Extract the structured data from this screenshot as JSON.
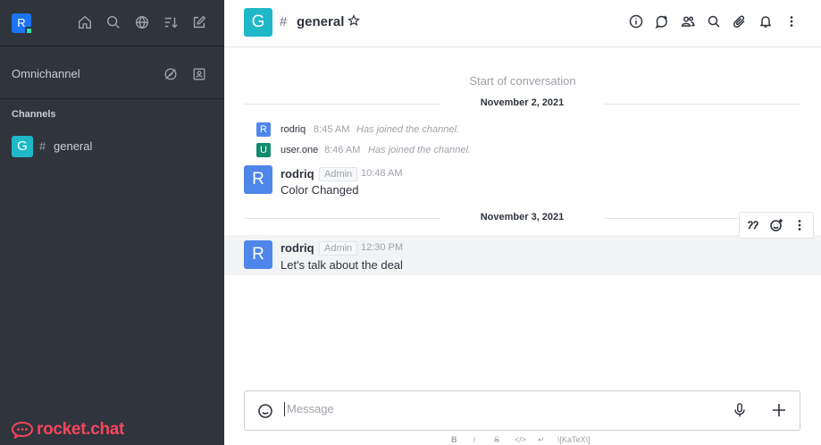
{
  "colors": {
    "sidebar_bg": "#2f343d",
    "brand": "#f5455c",
    "channel_avatar": "#1fb8c9",
    "user_avatar_r": "#4f86ea",
    "user_avatar_u": "#138a6d"
  },
  "sidebar": {
    "user_avatar_letter": "R",
    "top_icons": [
      "home-icon",
      "search-icon",
      "directory-icon",
      "sort-icon",
      "create-new-icon"
    ],
    "omnichannel_label": "Omnichannel",
    "section_label": "Channels",
    "rooms": [
      {
        "avatar": "G",
        "hash": "#",
        "name": "general"
      }
    ],
    "brand_text": "rocket.chat"
  },
  "header": {
    "avatar": "G",
    "hash": "#",
    "title": "general",
    "icons": [
      "info-icon",
      "discussion-icon",
      "members-icon",
      "search-icon",
      "attachment-icon",
      "notification-icon",
      "kebab-menu-icon"
    ]
  },
  "conversation": {
    "start_text": "Start of conversation",
    "dividers": [
      "November 2, 2021",
      "November 3, 2021"
    ],
    "system_messages": [
      {
        "avatar": "R",
        "user": "rodriq",
        "time": "8:45 AM",
        "text": "Has joined the channel."
      },
      {
        "avatar": "U",
        "user": "user.one",
        "time": "8:46 AM",
        "text": "Has joined the channel."
      }
    ],
    "messages": [
      {
        "avatar": "R",
        "user": "rodriq",
        "role": "Admin",
        "time": "10:48 AM",
        "text": "Color Changed"
      },
      {
        "avatar": "R",
        "user": "rodriq",
        "role": "Admin",
        "time": "12:30 PM",
        "text": "Let's talk about the deal"
      }
    ],
    "message_actions": [
      "quote-icon",
      "add-reaction-icon",
      "kebab-menu-icon"
    ]
  },
  "composer": {
    "placeholder": "Message",
    "formatting": [
      "B",
      "i",
      "S",
      "</>",
      "↵",
      "\\[KaTeX\\]"
    ]
  }
}
